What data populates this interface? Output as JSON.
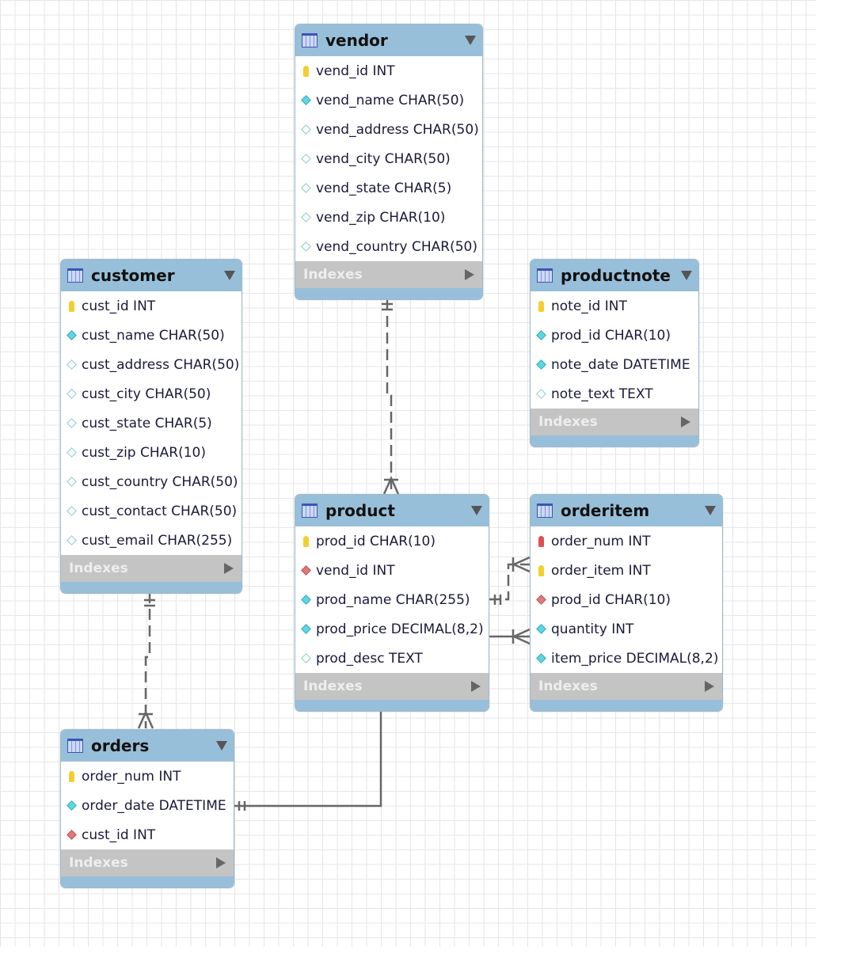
{
  "colors": {
    "header": "#97bfd9",
    "indexes_bar": "#c4c4c4",
    "pk_key": "#f2cf2e",
    "pk_fk_key": "#e05050",
    "fk_diamond": "#e07a7a",
    "notnull_diamond": "#5ed7e0",
    "nullable_diamond": "#ffffff"
  },
  "indexes_label": "Indexes",
  "tables": [
    {
      "name": "vendor",
      "columns": [
        {
          "text": "vend_id INT",
          "icon": "pk"
        },
        {
          "text": "vend_name CHAR(50)",
          "icon": "nn"
        },
        {
          "text": "vend_address CHAR(50)",
          "icon": "null"
        },
        {
          "text": "vend_city CHAR(50)",
          "icon": "null"
        },
        {
          "text": "vend_state CHAR(5)",
          "icon": "null"
        },
        {
          "text": "vend_zip CHAR(10)",
          "icon": "null"
        },
        {
          "text": "vend_country CHAR(50)",
          "icon": "null"
        }
      ]
    },
    {
      "name": "customer",
      "columns": [
        {
          "text": "cust_id INT",
          "icon": "pk"
        },
        {
          "text": "cust_name CHAR(50)",
          "icon": "nn"
        },
        {
          "text": "cust_address CHAR(50)",
          "icon": "null"
        },
        {
          "text": "cust_city CHAR(50)",
          "icon": "null"
        },
        {
          "text": "cust_state CHAR(5)",
          "icon": "null"
        },
        {
          "text": "cust_zip CHAR(10)",
          "icon": "null"
        },
        {
          "text": "cust_country CHAR(50)",
          "icon": "null"
        },
        {
          "text": "cust_contact CHAR(50)",
          "icon": "null"
        },
        {
          "text": "cust_email CHAR(255)",
          "icon": "null"
        }
      ]
    },
    {
      "name": "productnote",
      "columns": [
        {
          "text": "note_id INT",
          "icon": "pk"
        },
        {
          "text": "prod_id CHAR(10)",
          "icon": "nn"
        },
        {
          "text": "note_date DATETIME",
          "icon": "nn"
        },
        {
          "text": "note_text TEXT",
          "icon": "null"
        }
      ]
    },
    {
      "name": "product",
      "columns": [
        {
          "text": "prod_id CHAR(10)",
          "icon": "pk"
        },
        {
          "text": "vend_id INT",
          "icon": "fk"
        },
        {
          "text": "prod_name CHAR(255)",
          "icon": "nn"
        },
        {
          "text": "prod_price DECIMAL(8,2)",
          "icon": "nn"
        },
        {
          "text": "prod_desc TEXT",
          "icon": "null"
        }
      ]
    },
    {
      "name": "orderitem",
      "columns": [
        {
          "text": "order_num INT",
          "icon": "pkfk"
        },
        {
          "text": "order_item INT",
          "icon": "pk"
        },
        {
          "text": "prod_id CHAR(10)",
          "icon": "fk"
        },
        {
          "text": "quantity INT",
          "icon": "nn"
        },
        {
          "text": "item_price DECIMAL(8,2)",
          "icon": "nn"
        }
      ]
    },
    {
      "name": "orders",
      "columns": [
        {
          "text": "order_num INT",
          "icon": "pk"
        },
        {
          "text": "order_date DATETIME",
          "icon": "nn"
        },
        {
          "text": "cust_id INT",
          "icon": "fk"
        }
      ]
    }
  ],
  "relationships": [
    {
      "from": "vendor",
      "to": "product",
      "type": "one-to-many",
      "identifying": false
    },
    {
      "from": "customer",
      "to": "orders",
      "type": "one-to-many",
      "identifying": false
    },
    {
      "from": "product",
      "to": "orderitem",
      "type": "one-to-many",
      "identifying": false
    },
    {
      "from": "product",
      "to": "orderitem",
      "type": "one-to-many",
      "identifying": true
    },
    {
      "from": "orders",
      "to": "product",
      "type": "one-to-one",
      "identifying": true
    }
  ]
}
